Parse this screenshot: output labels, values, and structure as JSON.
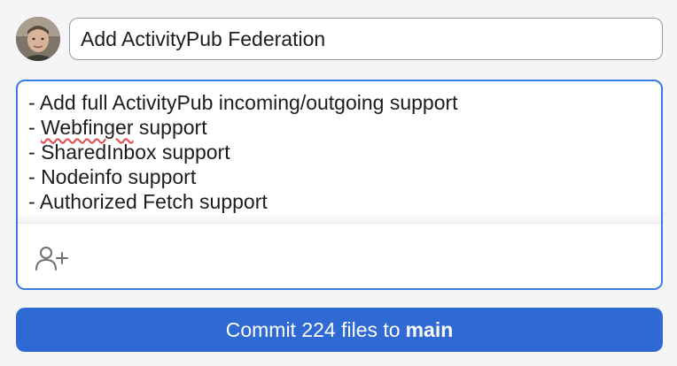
{
  "commit": {
    "summary_value": "Add ActivityPub Federation",
    "description_lines": [
      {
        "prefix": "- ",
        "misspelled": "",
        "text": "Add full ActivityPub incoming/outgoing support"
      },
      {
        "prefix": "- ",
        "misspelled": "Webfinger",
        "text": " support"
      },
      {
        "prefix": "- ",
        "misspelled": "",
        "text": "SharedInbox support"
      },
      {
        "prefix": "- ",
        "misspelled": "",
        "text": "Nodeinfo support"
      },
      {
        "prefix": "- ",
        "misspelled": "",
        "text": "Authorized Fetch support"
      }
    ],
    "button_text": "Commit 224 files to",
    "branch": "main"
  },
  "icons": {
    "avatar": "user-avatar",
    "coauthor": "add-coauthor-icon"
  },
  "colors": {
    "accent": "#2f69d4",
    "focus_border": "#3b7be6",
    "spellcheck": "#e5484d"
  }
}
